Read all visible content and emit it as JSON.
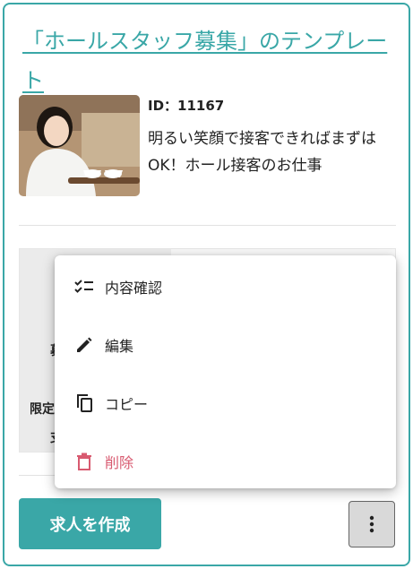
{
  "card": {
    "title": "「ホールスタッフ募集」のテンプレート",
    "id_label": "ID：11167",
    "description": "明るい笑顔で接客できればまずはOK！ホール接客のお仕事"
  },
  "table": {
    "fragment_1": "募",
    "fragment_2": "限定",
    "fragment_3": "支"
  },
  "menu": {
    "items": [
      {
        "label": "内容確認",
        "icon": "checklist-icon"
      },
      {
        "label": "編集",
        "icon": "pencil-icon"
      },
      {
        "label": "コピー",
        "icon": "copy-icon"
      },
      {
        "label": "削除",
        "icon": "trash-icon",
        "color": "#d85a70"
      }
    ]
  },
  "actions": {
    "create_label": "求人を作成",
    "more_icon": "more-vert-icon"
  },
  "colors": {
    "accent": "#3aa7a7",
    "danger": "#d85a70"
  }
}
